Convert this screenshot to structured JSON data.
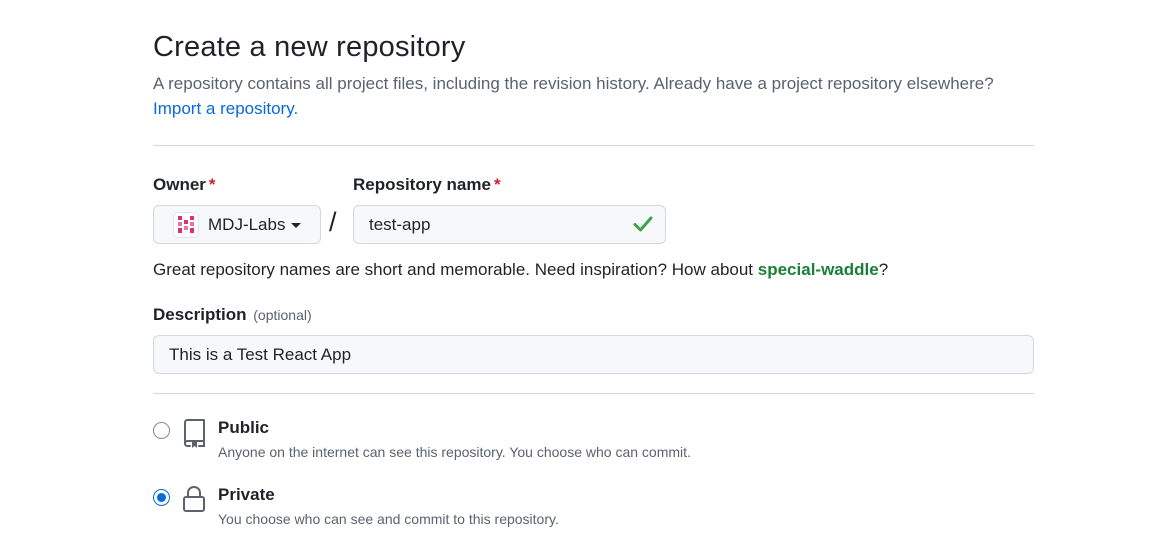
{
  "header": {
    "title": "Create a new repository",
    "subtitle": "A repository contains all project files, including the revision history. Already have a project repository elsewhere?",
    "import_link": "Import a repository."
  },
  "owner": {
    "label": "Owner",
    "required_mark": "*",
    "value": "MDJ-Labs",
    "avatar_icon": "org-avatar-icon"
  },
  "separator": "/",
  "repo_name": {
    "label": "Repository name",
    "required_mark": "*",
    "value": "test-app",
    "status_icon": "check-icon"
  },
  "hint": {
    "text": "Great repository names are short and memorable. Need inspiration? How about ",
    "suggestion": "special-waddle",
    "suffix": "?"
  },
  "description": {
    "label": "Description",
    "optional": "(optional)",
    "value": "This is a Test React App"
  },
  "visibility": {
    "options": [
      {
        "title": "Public",
        "desc": "Anyone on the internet can see this repository. You choose who can commit.",
        "icon": "repo-icon",
        "selected": false
      },
      {
        "title": "Private",
        "desc": "You choose who can see and commit to this repository.",
        "icon": "lock-icon",
        "selected": true
      }
    ]
  },
  "colors": {
    "link": "#0969da",
    "success": "#1a7f37",
    "required": "#d1242f",
    "muted": "#59636e"
  }
}
